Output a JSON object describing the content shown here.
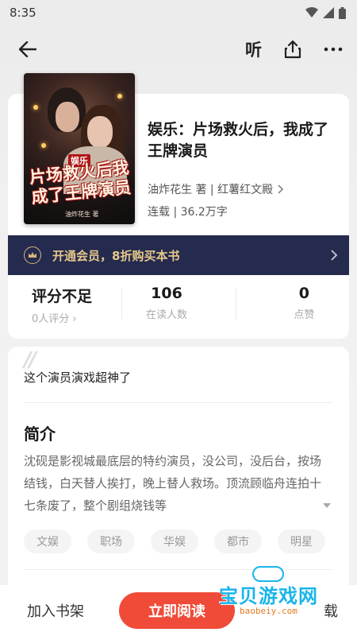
{
  "status_bar": {
    "time": "8:35"
  },
  "nav": {
    "back_icon": "back-arrow-icon",
    "listen_label": "听",
    "share_icon": "share-icon",
    "more_icon": "more-icon"
  },
  "book": {
    "cover_art_title": "片场救火后我成了王牌演员",
    "cover_art_tag": "娱乐",
    "cover_art_author": "油炸花生 著",
    "title": "娱乐：片场救火后，我成了王牌演员",
    "author": "油炸花生 著 | 红薯红文殿",
    "meta": "连载 | 36.2万字"
  },
  "vip_banner": {
    "text": "开通会员，8折购买本书",
    "color": "#e6c889"
  },
  "stats": [
    {
      "value": "评分不足",
      "label": "0人评分"
    },
    {
      "value": "106",
      "label": "在读人数"
    },
    {
      "value": "0",
      "label": "点赞"
    }
  ],
  "detail": {
    "quote_mark": "//",
    "quote": "这个演员演戏超神了",
    "intro_heading": "简介",
    "intro_text": "沈砚是影视城最底层的特约演员，没公司，没后台，按场结钱，白天替人挨打，晚上替人救场。顶流顾临舟连拍十七条废了，整个剧组烧钱等"
  },
  "tags": [
    "文娱",
    "职场",
    "华娱",
    "都市",
    "明星"
  ],
  "bottom_bar": {
    "shelf_label": "加入书架",
    "read_label": "立即阅读",
    "download_label": "载"
  },
  "watermark": {
    "main": "宝贝游戏网",
    "sub": "baobeiy.com"
  },
  "colors": {
    "accent": "#f04b38",
    "vip_bg": "#252a4f"
  }
}
